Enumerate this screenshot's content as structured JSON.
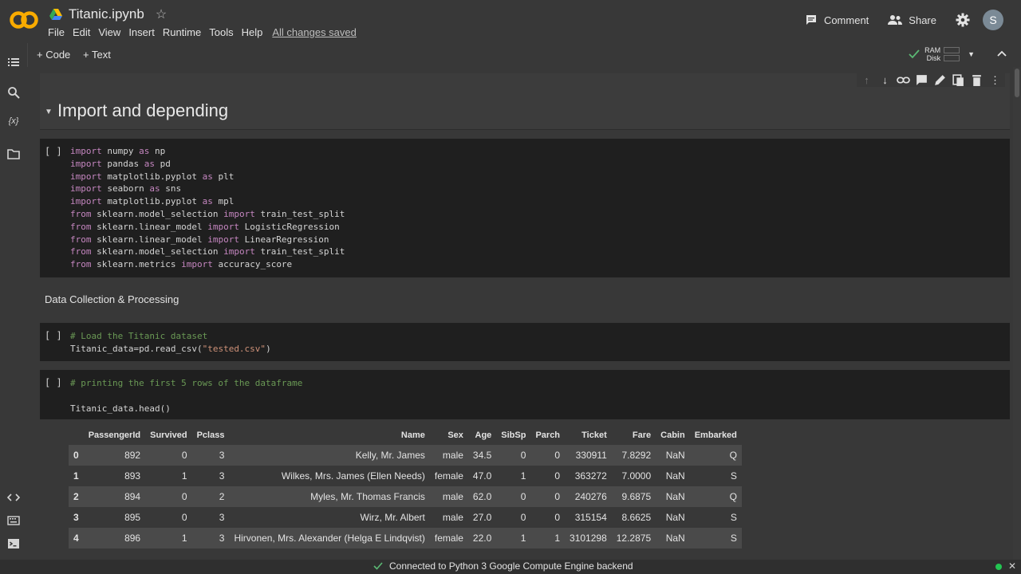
{
  "app": {
    "logo_text": "CO",
    "notebook_title": "Titanic.ipynb"
  },
  "menu": [
    "File",
    "Edit",
    "View",
    "Insert",
    "Runtime",
    "Tools",
    "Help"
  ],
  "saved_status": "All changes saved",
  "top_right": {
    "comment_label": "Comment",
    "share_label": "Share",
    "avatar_letter": "S"
  },
  "toolbar": {
    "code_label": "+ Code",
    "text_label": "+ Text",
    "ram_label": "RAM",
    "disk_label": "Disk"
  },
  "cells": {
    "heading": "Import and depending",
    "text_cell": "Data Collection & Processing",
    "run_label": "[ ]"
  },
  "code1": [
    [
      "import",
      " numpy ",
      "as",
      " np"
    ],
    [
      "import",
      " pandas ",
      "as",
      " pd"
    ],
    [
      "import",
      " matplotlib.pyplot ",
      "as",
      " plt"
    ],
    [
      "import",
      " seaborn ",
      "as",
      " sns"
    ],
    [
      "import",
      " matplotlib.pyplot ",
      "as",
      " mpl"
    ],
    [
      "from",
      " sklearn.model_selection ",
      "import",
      " train_test_split"
    ],
    [
      "from",
      " sklearn.linear_model ",
      "import",
      " LogisticRegression"
    ],
    [
      "from",
      " sklearn.linear_model ",
      "import",
      " LinearRegression"
    ],
    [
      "from",
      " sklearn.model_selection ",
      "import",
      " train_test_split"
    ],
    [
      "from",
      " sklearn.metrics ",
      "import",
      " accuracy_score"
    ]
  ],
  "code2": {
    "comment": "# Load the Titanic dataset",
    "line_pre": "Titanic_data=pd.read_csv(",
    "line_str": "\"tested.csv\"",
    "line_post": ")"
  },
  "code3": {
    "comment": "# printing the first 5 rows of the dataframe",
    "line": "Titanic_data.head()"
  },
  "dataframe": {
    "columns": [
      "",
      "PassengerId",
      "Survived",
      "Pclass",
      "Name",
      "Sex",
      "Age",
      "SibSp",
      "Parch",
      "Ticket",
      "Fare",
      "Cabin",
      "Embarked"
    ],
    "rows": [
      [
        "0",
        "892",
        "0",
        "3",
        "Kelly, Mr. James",
        "male",
        "34.5",
        "0",
        "0",
        "330911",
        "7.8292",
        "NaN",
        "Q"
      ],
      [
        "1",
        "893",
        "1",
        "3",
        "Wilkes, Mrs. James (Ellen Needs)",
        "female",
        "47.0",
        "1",
        "0",
        "363272",
        "7.0000",
        "NaN",
        "S"
      ],
      [
        "2",
        "894",
        "0",
        "2",
        "Myles, Mr. Thomas Francis",
        "male",
        "62.0",
        "0",
        "0",
        "240276",
        "9.6875",
        "NaN",
        "Q"
      ],
      [
        "3",
        "895",
        "0",
        "3",
        "Wirz, Mr. Albert",
        "male",
        "27.0",
        "0",
        "0",
        "315154",
        "8.6625",
        "NaN",
        "S"
      ],
      [
        "4",
        "896",
        "1",
        "3",
        "Hirvonen, Mrs. Alexander (Helga E Lindqvist)",
        "female",
        "22.0",
        "1",
        "1",
        "3101298",
        "12.2875",
        "NaN",
        "S"
      ]
    ]
  },
  "status": {
    "text": "Connected to Python 3 Google Compute Engine backend"
  },
  "colors": {
    "accent_orange": "#f9ab00",
    "connected_green": "#23c552"
  }
}
